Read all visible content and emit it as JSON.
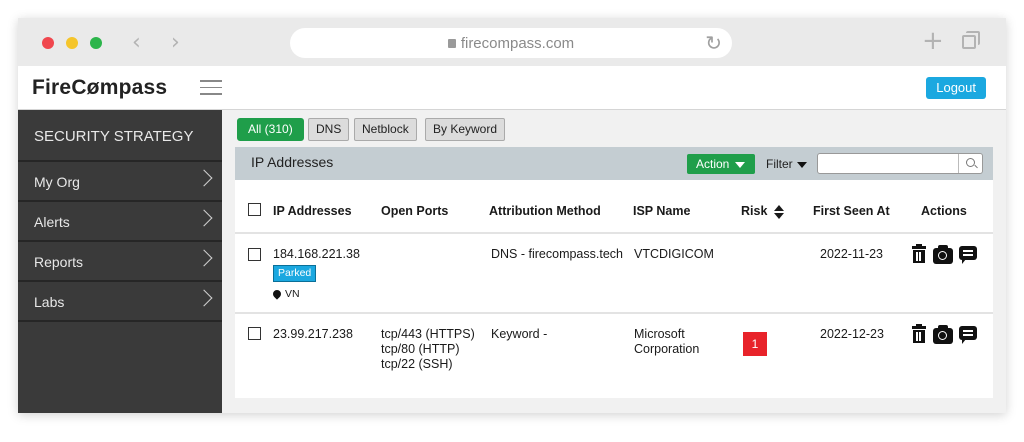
{
  "browser": {
    "url": "firecompass.com",
    "back_icon": "‹",
    "forward_icon": "›",
    "reload_icon": "↻",
    "new_tab_icon": "+"
  },
  "header": {
    "logo": "FireCømpass",
    "logout_label": "Logout"
  },
  "sidebar": {
    "title": "SECURITY STRATEGY",
    "items": [
      {
        "label": "My Org"
      },
      {
        "label": "Alerts"
      },
      {
        "label": "Reports"
      },
      {
        "label": "Labs"
      }
    ]
  },
  "filters": {
    "all": "All (310)",
    "dns": "DNS",
    "netblock": "Netblock",
    "by_keyword": "By Keyword"
  },
  "panel": {
    "title": "IP Addresses",
    "action_label": "Action",
    "filter_label": "Filter",
    "search_value": ""
  },
  "table": {
    "columns": {
      "ip": "IP Addresses",
      "ports": "Open Ports",
      "attribution": "Attribution Method",
      "isp": "ISP Name",
      "risk": "Risk",
      "first_seen": "First Seen At",
      "actions": "Actions"
    },
    "rows": [
      {
        "ip": "184.168.221.38",
        "badge": "Parked",
        "location": "VN",
        "ports": [
          "",
          "",
          ""
        ],
        "attribution": "DNS - firecompass.tech",
        "isp": [
          "VTCDIGICOM",
          ""
        ],
        "risk": "",
        "first_seen": "2022-11-23"
      },
      {
        "ip": "23.99.217.238",
        "badge": "",
        "location": "",
        "ports": [
          "tcp/443 (HTTPS)",
          "tcp/80 (HTTP)",
          "tcp/22 (SSH)"
        ],
        "attribution": "Keyword -",
        "isp": [
          "Microsoft",
          "Corporation"
        ],
        "risk": "1",
        "first_seen": "2022-12-23"
      }
    ]
  },
  "colors": {
    "accent_green": "#1f9e4a",
    "accent_blue": "#1ba8e0",
    "risk_red": "#e8232a",
    "sidebar_bg": "#3a3a3a"
  }
}
